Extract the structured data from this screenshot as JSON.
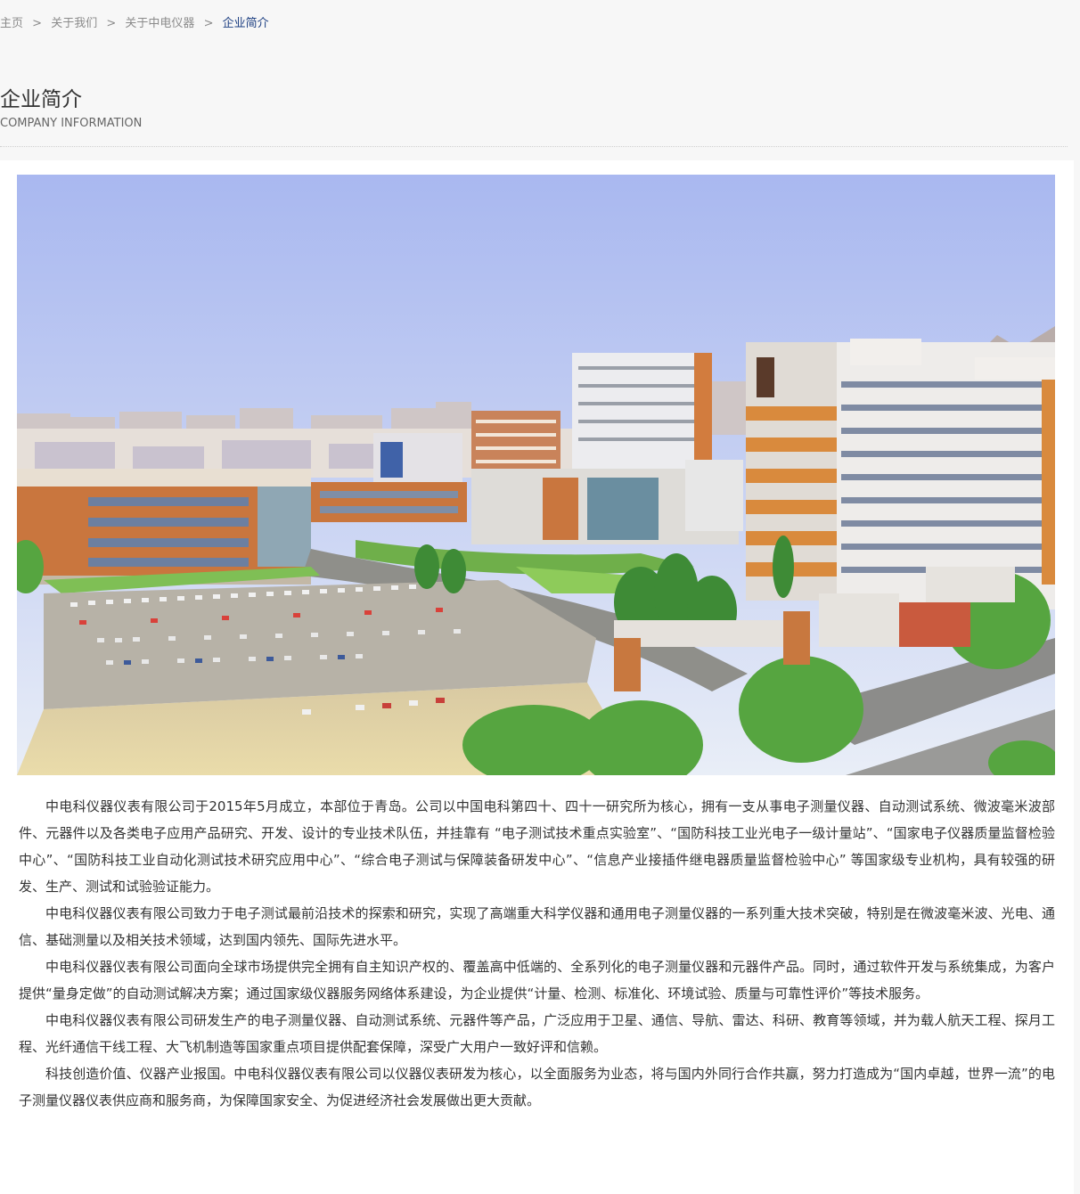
{
  "breadcrumb": {
    "home": "主页",
    "separator": ">",
    "about_us": "关于我们",
    "about_company": "关于中电仪器",
    "current": "企业简介"
  },
  "header": {
    "title": "企业简介",
    "subtitle": "COMPANY INFORMATION"
  },
  "colors": {
    "breadcrumb_current": "#1d3f82",
    "text": "#333333",
    "page_bg": "#f7f7f7",
    "content_bg": "#ffffff"
  },
  "article": {
    "paragraphs": [
      "中电科仪器仪表有限公司于2015年5月成立，本部位于青岛。公司以中国电科第四十、四十一研究所为核心，拥有一支从事电子测量仪器、自动测试系统、微波毫米波部件、元器件以及各类电子应用产品研究、开发、设计的专业技术队伍，并挂靠有 “电子测试技术重点实验室”、“国防科技工业光电子一级计量站”、“国家电子仪器质量监督检验中心”、“国防科技工业自动化测试技术研究应用中心”、“综合电子测试与保障装备研发中心”、“信息产业接插件继电器质量监督检验中心” 等国家级专业机构，具有较强的研发、生产、测试和试验验证能力。",
      "中电科仪器仪表有限公司致力于电子测试最前沿技术的探索和研究，实现了高端重大科学仪器和通用电子测量仪器的一系列重大技术突破，特别是在微波毫米波、光电、通信、基础测量以及相关技术领域，达到国内领先、国际先进水平。",
      "中电科仪器仪表有限公司面向全球市场提供完全拥有自主知识产权的、覆盖高中低端的、全系列化的电子测量仪器和元器件产品。同时，通过软件开发与系统集成，为客户提供“量身定做”的自动测试解决方案；通过国家级仪器服务网络体系建设，为企业提供“计量、检测、标准化、环境试验、质量与可靠性评价”等技术服务。",
      "中电科仪器仪表有限公司研发生产的电子测量仪器、自动测试系统、元器件等产品，广泛应用于卫星、通信、导航、雷达、科研、教育等领域，并为载人航天工程、探月工程、光纤通信干线工程、大飞机制造等国家重点项目提供配套保障，深受广大用户一致好评和信赖。",
      "科技创造价值、仪器产业报国。中电科仪器仪表有限公司以仪器仪表研发为核心，以全面服务为业态，将与国内外同行合作共赢，努力打造成为“国内卓越，世界一流”的电子测量仪器仪表供应商和服务商，为保障国家安全、为促进经济社会发展做出更大贡献。"
    ]
  }
}
